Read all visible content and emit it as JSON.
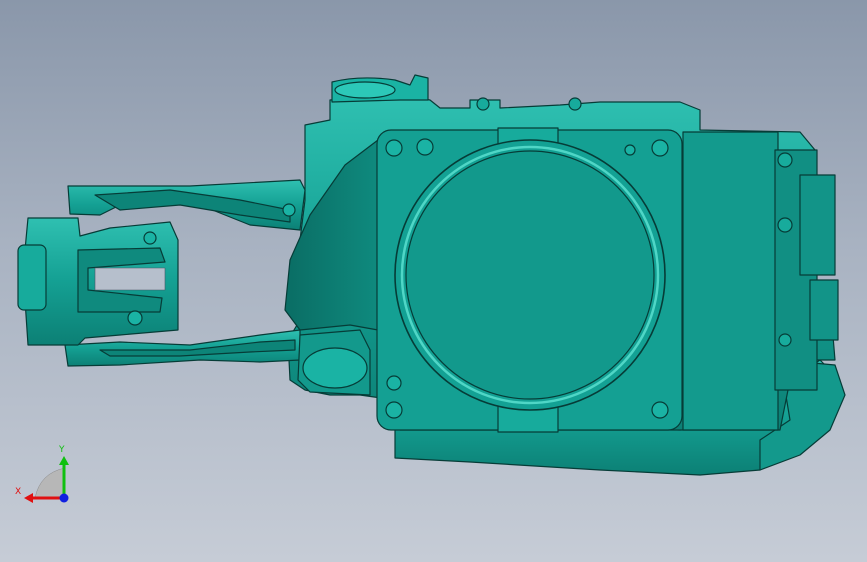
{
  "colors": {
    "background_top": "#8a97aa",
    "background_bottom": "#c6ccd6",
    "model_fill": "#14a093",
    "model_dark": "#0a6d64",
    "model_edge": "#063c37",
    "model_highlight": "#4fd6c6",
    "axis_x": "#e01010",
    "axis_y": "#10c010",
    "axis_z": "#1020e0"
  },
  "triad": {
    "x_label": "X",
    "y_label": "Y"
  }
}
